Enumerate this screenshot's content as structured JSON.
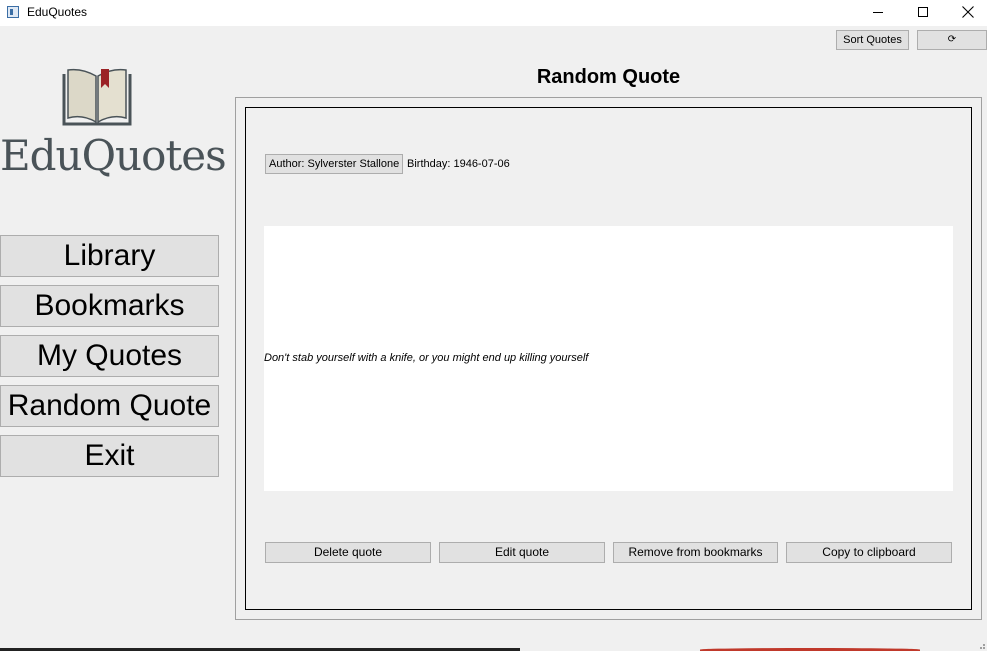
{
  "window": {
    "title": "EduQuotes"
  },
  "toolbar": {
    "sort_label": "Sort Quotes",
    "refresh_label": "⟳"
  },
  "logo": {
    "text": "EduQuotes"
  },
  "nav": {
    "items": [
      {
        "label": "Library"
      },
      {
        "label": "Bookmarks"
      },
      {
        "label": "My Quotes"
      },
      {
        "label": "Random Quote"
      },
      {
        "label": "Exit"
      }
    ]
  },
  "page": {
    "title": "Random Quote"
  },
  "quote": {
    "author_button": "Author: Sylverster Stallone",
    "birthday": "Birthday: 1946-07-06",
    "text": "Don't stab yourself with a knife, or you might end up killing yourself"
  },
  "actions": {
    "delete": "Delete quote",
    "edit": "Edit quote",
    "remove_bookmark": "Remove from bookmarks",
    "copy": "Copy to clipboard"
  },
  "colors": {
    "accent_red": "#9b2226",
    "logo_text": "#4a5358"
  }
}
